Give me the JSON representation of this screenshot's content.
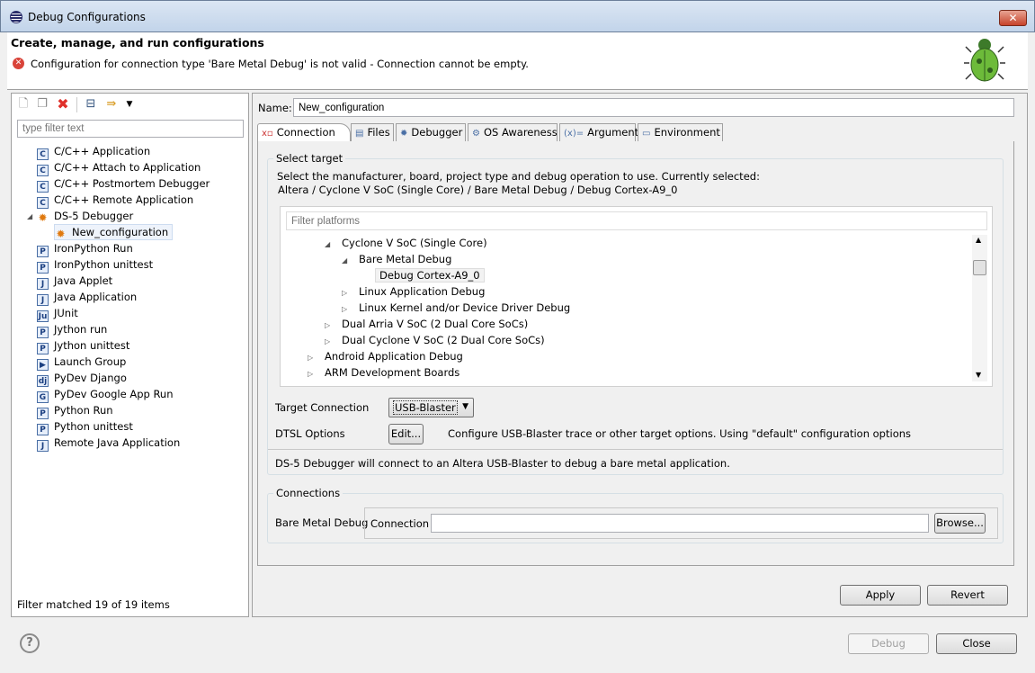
{
  "window": {
    "title": "Debug Configurations",
    "close_label": "✕"
  },
  "header": {
    "title": "Create, manage, and run configurations",
    "error": "Configuration for connection type 'Bare Metal Debug' is not valid - Connection cannot be empty."
  },
  "left": {
    "filter_placeholder": "type filter text",
    "items": [
      {
        "label": "C/C++ Application",
        "icon": "C"
      },
      {
        "label": "C/C++ Attach to Application",
        "icon": "C"
      },
      {
        "label": "C/C++ Postmortem Debugger",
        "icon": "C"
      },
      {
        "label": "C/C++ Remote Application",
        "icon": "C"
      },
      {
        "label": "DS-5 Debugger",
        "icon": "✹"
      },
      {
        "label": "New_configuration",
        "icon": "✹"
      },
      {
        "label": "IronPython Run",
        "icon": "P"
      },
      {
        "label": "IronPython unittest",
        "icon": "P"
      },
      {
        "label": "Java Applet",
        "icon": "J"
      },
      {
        "label": "Java Application",
        "icon": "J"
      },
      {
        "label": "JUnit",
        "icon": "Ju"
      },
      {
        "label": "Jython run",
        "icon": "P"
      },
      {
        "label": "Jython unittest",
        "icon": "P"
      },
      {
        "label": "Launch Group",
        "icon": "▶"
      },
      {
        "label": "PyDev Django",
        "icon": "dj"
      },
      {
        "label": "PyDev Google App Run",
        "icon": "G"
      },
      {
        "label": "Python Run",
        "icon": "P"
      },
      {
        "label": "Python unittest",
        "icon": "P"
      },
      {
        "label": "Remote Java Application",
        "icon": "J"
      }
    ],
    "status": "Filter matched 19 of 19 items"
  },
  "right": {
    "name_label": "Name:",
    "name_value": "New_configuration",
    "tabs": [
      {
        "label": "Connection",
        "icon": "x▫"
      },
      {
        "label": "Files",
        "icon": "▤"
      },
      {
        "label": "Debugger",
        "icon": "✹"
      },
      {
        "label": "OS Awareness",
        "icon": "⚙"
      },
      {
        "label": "Arguments",
        "icon": "(x)="
      },
      {
        "label": "Environment",
        "icon": "▭"
      }
    ],
    "select_target": {
      "legend": "Select target",
      "desc1": "Select the manufacturer, board, project type and debug operation to use. Currently selected:",
      "desc2": "Altera / Cyclone V SoC (Single Core) / Bare Metal Debug / Debug Cortex-A9_0",
      "filter_placeholder": "Filter platforms",
      "tree": [
        {
          "label": "Cyclone V SoC (Single Core)",
          "expanded": true
        },
        {
          "label": "Bare Metal Debug",
          "expanded": true
        },
        {
          "label": "Debug Cortex-A9_0",
          "selected": true
        },
        {
          "label": "Linux Application Debug"
        },
        {
          "label": "Linux Kernel and/or Device Driver Debug"
        },
        {
          "label": "Dual Arria V SoC (2 Dual Core SoCs)"
        },
        {
          "label": "Dual Cyclone V SoC (2 Dual Core SoCs)"
        },
        {
          "label": "Android Application Debug"
        },
        {
          "label": "ARM Development Boards"
        }
      ],
      "target_connection_label": "Target Connection",
      "target_connection_value": "USB-Blaster",
      "dtsl_label": "DTSL Options",
      "edit_label": "Edit...",
      "dtsl_desc": "Configure USB-Blaster trace or other target options. Using \"default\" configuration options",
      "summary": "DS-5 Debugger will connect to an Altera USB-Blaster to debug a bare metal application."
    },
    "connections": {
      "legend": "Connections",
      "type_label": "Bare Metal Debug",
      "connection_label": "Connection",
      "connection_value": "",
      "browse_label": "Browse..."
    },
    "apply_label": "Apply",
    "revert_label": "Revert"
  },
  "footer": {
    "help": "?",
    "debug_label": "Debug",
    "close_label": "Close"
  }
}
